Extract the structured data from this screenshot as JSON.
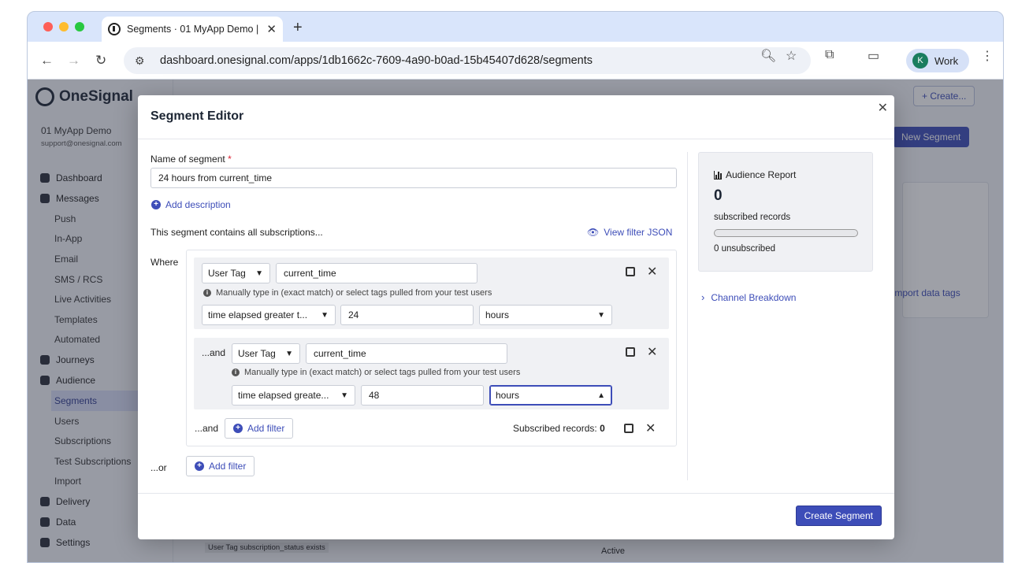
{
  "browser": {
    "tab_title": "Segments · 01 MyApp Demo |",
    "url": "dashboard.onesignal.com/apps/1db1662c-7609-4a90-b0ad-15b45407d628/segments",
    "profile_initial": "K",
    "profile_name": "Work"
  },
  "sidebar": {
    "logo": "OneSignal",
    "org_name": "01 MyApp Demo",
    "org_email": "support@onesignal.com",
    "items": [
      {
        "label": "Dashboard",
        "type": "main"
      },
      {
        "label": "Messages",
        "type": "main"
      },
      {
        "label": "Push",
        "type": "sub"
      },
      {
        "label": "In-App",
        "type": "sub"
      },
      {
        "label": "Email",
        "type": "sub"
      },
      {
        "label": "SMS / RCS",
        "type": "sub"
      },
      {
        "label": "Live Activities",
        "type": "sub"
      },
      {
        "label": "Templates",
        "type": "sub"
      },
      {
        "label": "Automated",
        "type": "sub"
      },
      {
        "label": "Journeys",
        "type": "main"
      },
      {
        "label": "Audience",
        "type": "main"
      },
      {
        "label": "Segments",
        "type": "sub-active"
      },
      {
        "label": "Users",
        "type": "sub"
      },
      {
        "label": "Subscriptions",
        "type": "sub"
      },
      {
        "label": "Test Subscriptions",
        "type": "sub"
      },
      {
        "label": "Import",
        "type": "sub"
      },
      {
        "label": "Delivery",
        "type": "main"
      },
      {
        "label": "Data",
        "type": "main"
      },
      {
        "label": "Settings",
        "type": "main"
      }
    ]
  },
  "background": {
    "create_button": "+ Create...",
    "new_segment_button": "New Segment",
    "import_tags_link": "Import data tags",
    "active_label": "Active",
    "tag_chip": "User Tag subscription_status exists"
  },
  "modal": {
    "title": "Segment Editor",
    "name_label": "Name of segment",
    "name_required": "*",
    "name_value": "24 hours from current_time",
    "add_description": "Add description",
    "contains_text": "This segment contains all subscriptions...",
    "view_json": "View filter JSON",
    "where_label": "Where",
    "filters": [
      {
        "prefix": "",
        "type": "User Tag",
        "key": "current_time",
        "hint": "Manually type in (exact match) or select tags pulled from your test users",
        "operator": "time elapsed greater t...",
        "value": "24",
        "unit": "hours"
      },
      {
        "prefix": "...and",
        "type": "User Tag",
        "key": "current_time",
        "hint": "Manually type in (exact match) or select tags pulled from your test users",
        "operator": "time elapsed greate...",
        "value": "48",
        "unit": "hours"
      }
    ],
    "and_label": "...and",
    "add_filter": "Add filter",
    "subscribed_label": "Subscribed records:",
    "subscribed_value": "0",
    "or_label": "...or",
    "or_add_filter": "Add filter",
    "report": {
      "title": "Audience Report",
      "count": "0",
      "subscribed_text": "subscribed records",
      "subscribed_fraction": 0,
      "unsubscribed_text": "0 unsubscribed"
    },
    "channel_breakdown": "Channel Breakdown",
    "create_button": "Create Segment"
  },
  "colors": {
    "accent": "#3d4db8",
    "overlay": "#282c3c"
  }
}
